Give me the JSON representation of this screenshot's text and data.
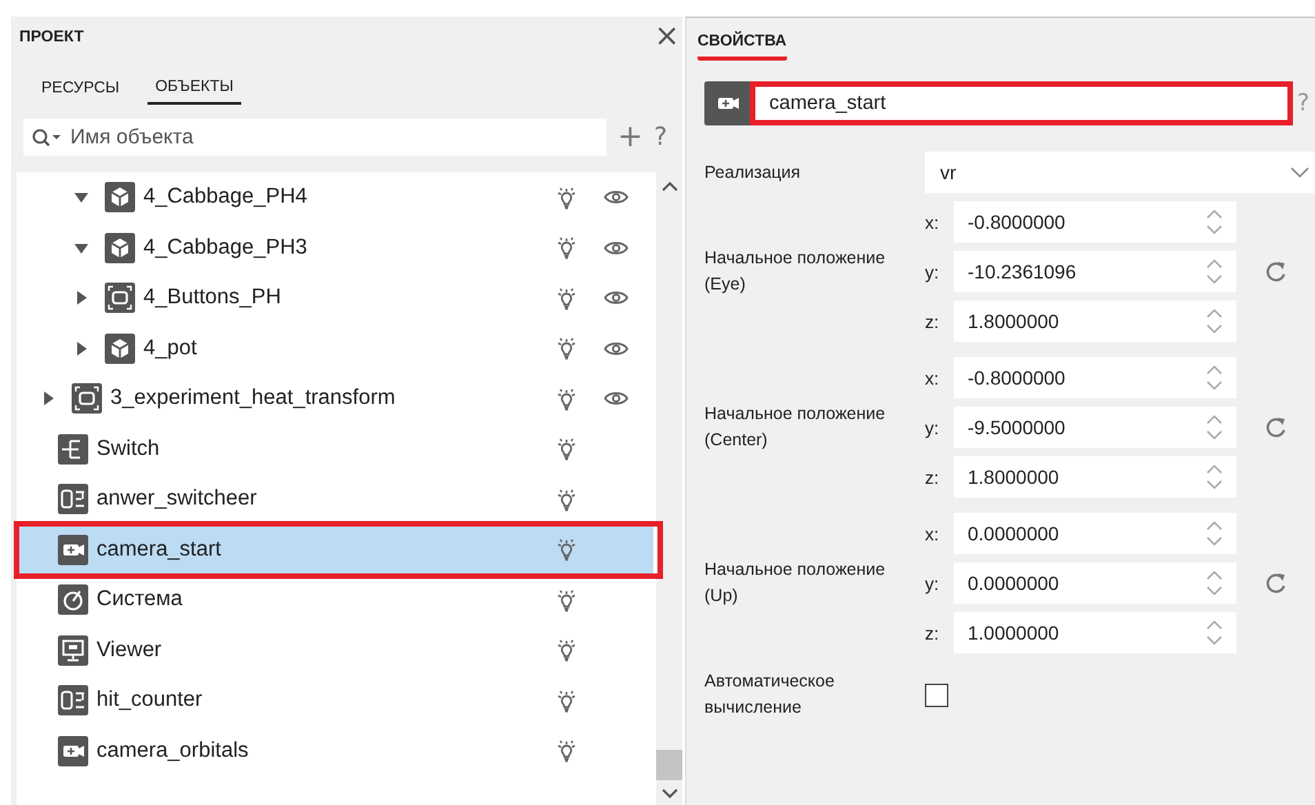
{
  "project_panel": {
    "title": "ПРОЕКТ",
    "close": "×",
    "tabs": [
      {
        "label": "РЕСУРСЫ",
        "selected": false
      },
      {
        "label": "ОБЪЕКТЫ",
        "selected": true
      }
    ],
    "search": {
      "placeholder": "Имя объекта"
    },
    "add": "+",
    "help": "?",
    "tree": [
      {
        "children": [
          {
            "label": "4_Cabbage_PH4",
            "kind": "object",
            "expanded": true,
            "eye": true,
            "selected": false,
            "annotated": false
          },
          {
            "label": "4_Cabbage_PH3",
            "kind": "object",
            "expanded": true,
            "eye": true,
            "selected": false,
            "annotated": false
          },
          {
            "label": "4_Buttons_PH",
            "kind": "group",
            "expanded": false,
            "eye": true,
            "selected": false,
            "annotated": false
          },
          {
            "label": "4_pot",
            "kind": "object",
            "expanded": false,
            "eye": true,
            "selected": false,
            "annotated": false
          }
        ]
      },
      {
        "label": "3_experiment_heat_transform",
        "kind": "group",
        "expanded": false,
        "eye": true,
        "selected": false,
        "annotated": false
      },
      {
        "label": "Switch",
        "kind": "switch",
        "eye": false,
        "selected": false,
        "annotated": false
      },
      {
        "label": "anwer_switcheer",
        "kind": "counter",
        "eye": false,
        "selected": false,
        "annotated": false
      },
      {
        "label": "camera_start",
        "kind": "camera",
        "eye": false,
        "selected": true,
        "annotated": true
      },
      {
        "label": "Система",
        "kind": "system",
        "eye": false,
        "selected": false,
        "annotated": false
      },
      {
        "label": "Viewer",
        "kind": "viewer",
        "eye": false,
        "selected": false,
        "annotated": false
      },
      {
        "label": "hit_counter",
        "kind": "counter",
        "eye": false,
        "selected": false,
        "annotated": false
      },
      {
        "label": "camera_orbitals",
        "kind": "camera",
        "eye": false,
        "selected": false,
        "annotated": false
      }
    ]
  },
  "properties_panel": {
    "title": "СВОЙСТВА",
    "title_annotated": true,
    "help": "?",
    "object": {
      "kind": "camera",
      "name": "camera_start",
      "annotated": true
    },
    "fields": [
      {
        "kind": "select",
        "label": "Реализация",
        "value": "vr"
      },
      {
        "kind": "vector",
        "label": "Начальное положение (Eye)",
        "components": [
          {
            "axis": "x:",
            "value": "-0.8000000"
          },
          {
            "axis": "y:",
            "value": "-10.2361096"
          },
          {
            "axis": "z:",
            "value": "1.8000000"
          }
        ]
      },
      {
        "kind": "vector",
        "label": "Начальное положение (Center)",
        "components": [
          {
            "axis": "x:",
            "value": "-0.8000000"
          },
          {
            "axis": "y:",
            "value": "-9.5000000"
          },
          {
            "axis": "z:",
            "value": "1.8000000"
          }
        ]
      },
      {
        "kind": "vector",
        "label": "Начальное положение (Up)",
        "components": [
          {
            "axis": "x:",
            "value": "0.0000000"
          },
          {
            "axis": "y:",
            "value": "0.0000000"
          },
          {
            "axis": "z:",
            "value": "1.0000000"
          }
        ]
      },
      {
        "kind": "checkbox",
        "label": "Автоматическое вычисление",
        "checked": false
      }
    ]
  }
}
